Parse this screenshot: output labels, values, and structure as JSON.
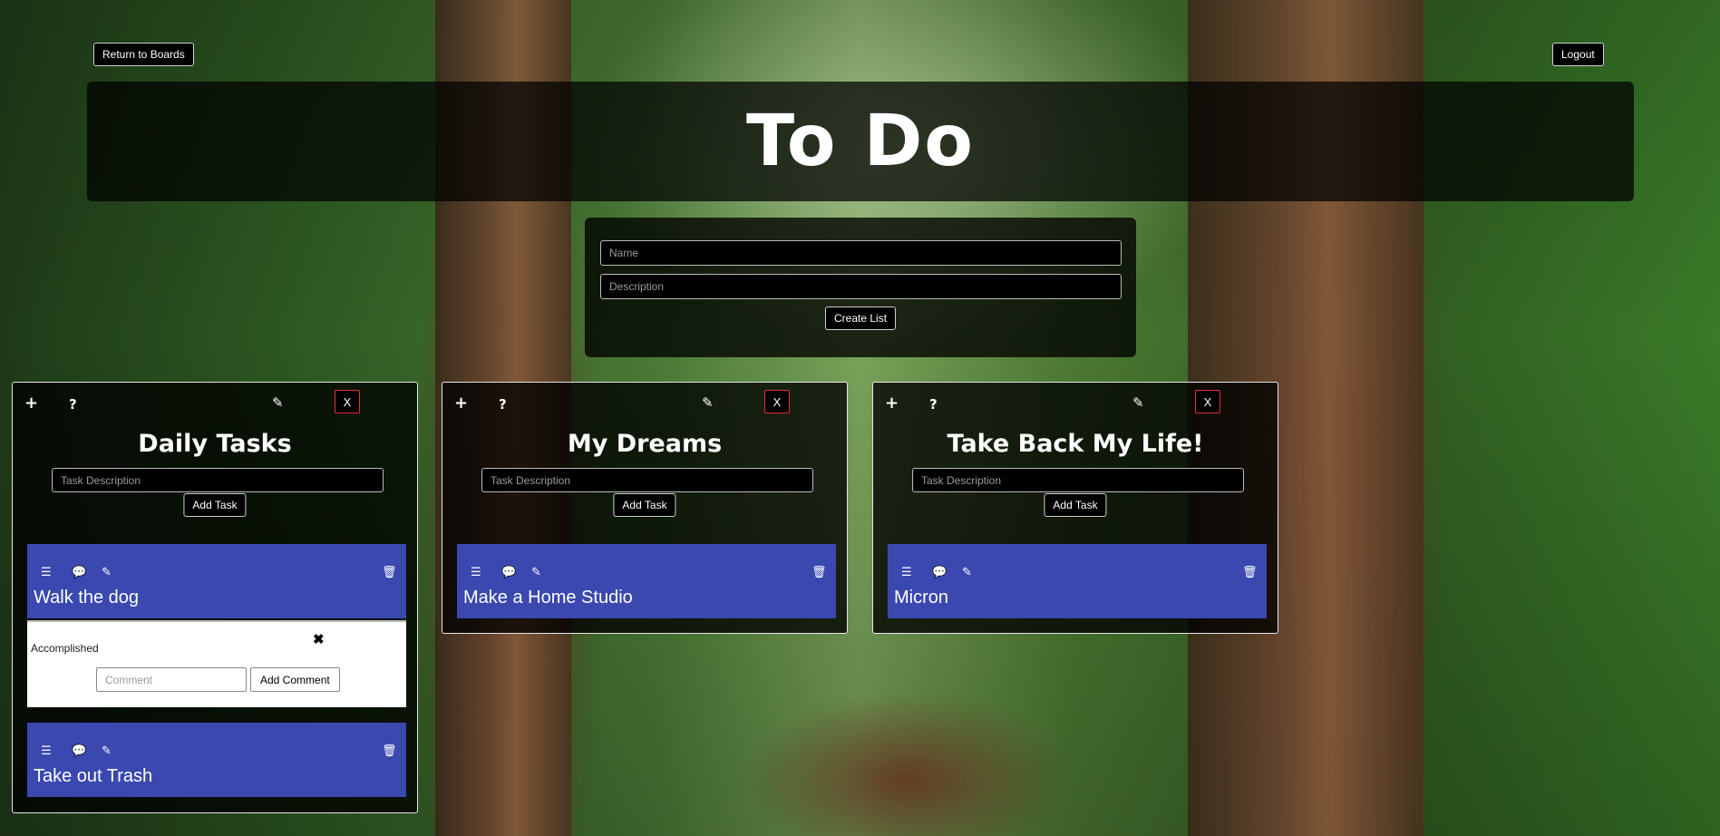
{
  "nav": {
    "return_label": "Return to Boards",
    "logout_label": "Logout"
  },
  "header": {
    "title": "To Do"
  },
  "create_form": {
    "name_placeholder": "Name",
    "description_placeholder": "Description",
    "submit_label": "Create List"
  },
  "card_controls": {
    "add_icon": "+",
    "help_icon": "?",
    "edit_icon": "✎",
    "delete_label": "X",
    "task_placeholder": "Task Description",
    "add_task_label": "Add Task"
  },
  "task_tools": {
    "details_icon": "☰",
    "comment_icon": "💬",
    "edit_icon": "✎",
    "trash_icon": "🗑"
  },
  "lists": [
    {
      "title": "Daily Tasks",
      "tasks": [
        {
          "name": "Walk the dog"
        },
        {
          "name": "Take out Trash"
        }
      ],
      "comment_panel": {
        "comment_text": "Accomplished",
        "close_icon": "✖",
        "comment_placeholder": "Comment",
        "add_comment_label": "Add Comment"
      }
    },
    {
      "title": "My Dreams",
      "tasks": [
        {
          "name": "Make a Home Studio"
        }
      ]
    },
    {
      "title": "Take Back My Life!",
      "tasks": [
        {
          "name": "Micron"
        }
      ]
    }
  ],
  "colors": {
    "task_bg": "#3a48b0",
    "delete_border": "#e03030"
  }
}
